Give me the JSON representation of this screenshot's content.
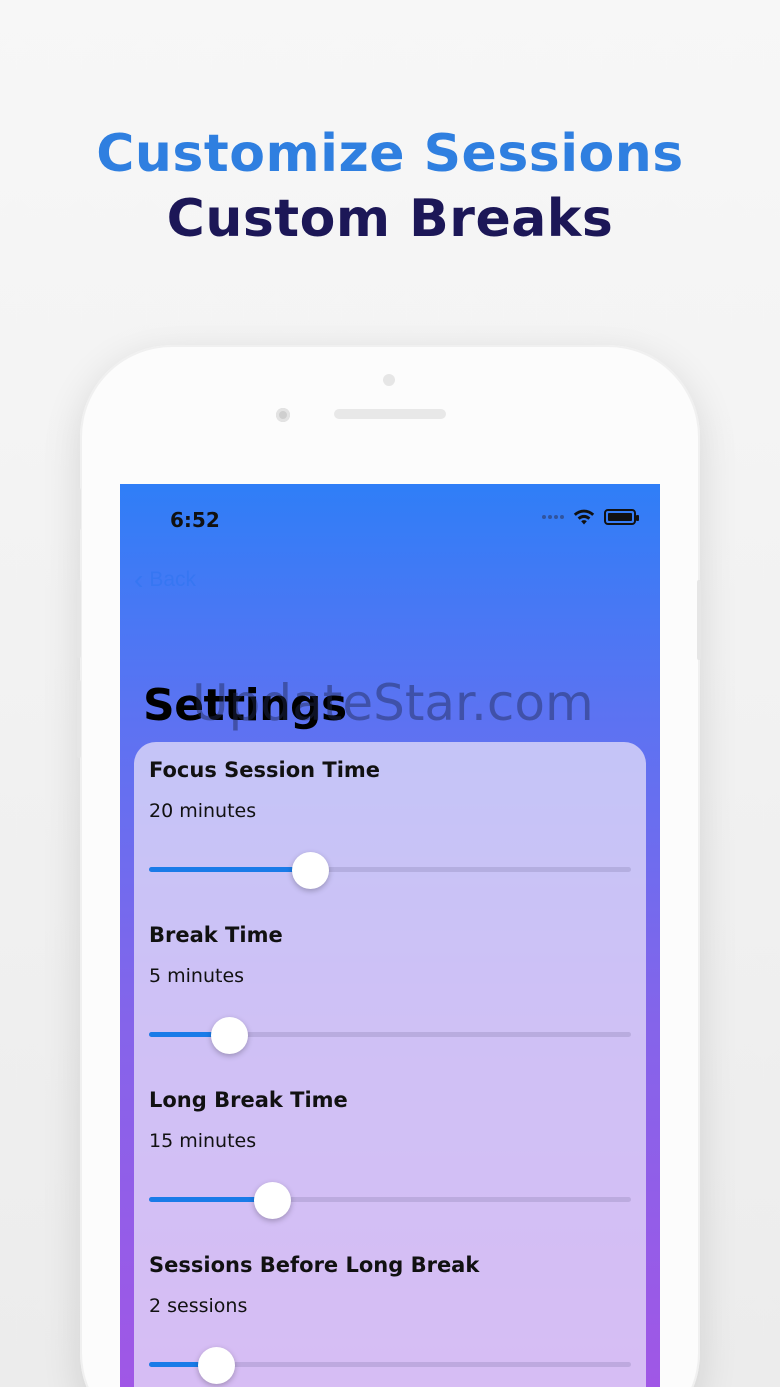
{
  "headline": {
    "line1": "Customize Sessions",
    "line2": "Custom Breaks"
  },
  "status_bar": {
    "time": "6:52"
  },
  "nav": {
    "back_label": "Back",
    "title": "Settings"
  },
  "watermark": "UpdateStar.com",
  "settings": [
    {
      "label": "Focus Session Time",
      "value": "20 minutes",
      "slider_fraction": 0.335
    },
    {
      "label": "Break Time",
      "value": "5 minutes",
      "slider_fraction": 0.165
    },
    {
      "label": "Long Break Time",
      "value": "15 minutes",
      "slider_fraction": 0.255
    },
    {
      "label": "Sessions Before Long Break",
      "value": "2 sessions",
      "slider_fraction": 0.14
    }
  ],
  "colors": {
    "headline_accent": "#2f7fe0",
    "headline_dark": "#1c1757",
    "slider_fill": "#1a7be8",
    "screen_gradient_top": "#2f7ef7",
    "screen_gradient_bottom": "#a057e6"
  }
}
